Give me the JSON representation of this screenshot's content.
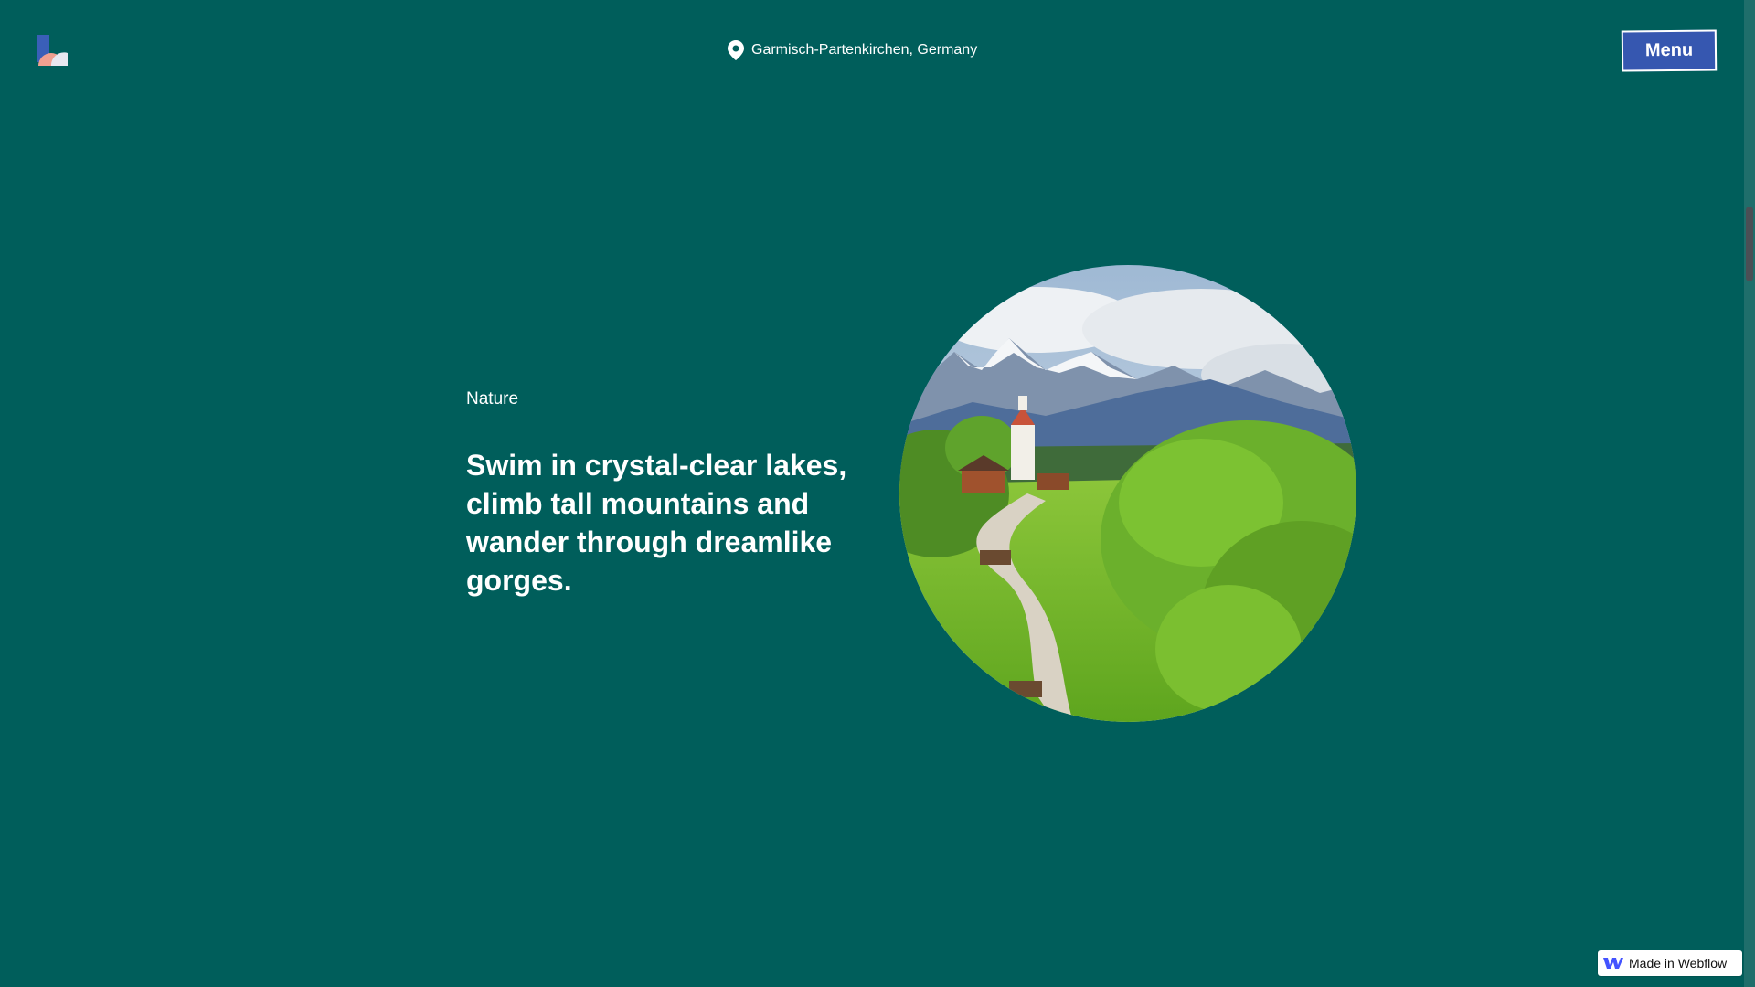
{
  "header": {
    "location": "Garmisch-Partenkirchen, Germany",
    "menu_label": "Menu"
  },
  "content": {
    "category": "Nature",
    "headline": "Swim in crystal-clear lakes, climb tall mountains and wander through dreamlike gorges."
  },
  "badge": {
    "label": "Made in Webflow"
  },
  "icons": {
    "logo": "brand-logo-icon",
    "location": "map-pin-icon",
    "webflow": "webflow-logo-icon"
  },
  "colors": {
    "background": "#005e5b",
    "menu_button": "#3657b0",
    "text": "#ffffff"
  }
}
